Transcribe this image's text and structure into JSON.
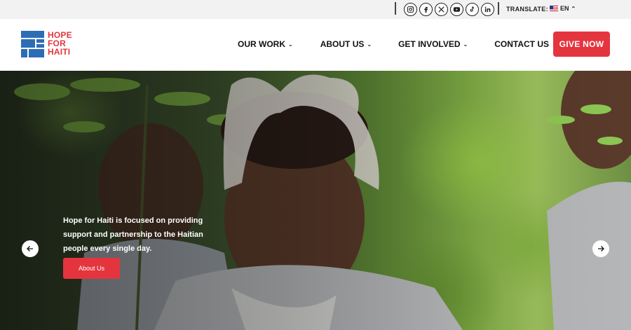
{
  "topbar": {
    "social_icons": [
      "instagram-icon",
      "facebook-icon",
      "x-icon",
      "youtube-icon",
      "tiktok-icon",
      "linkedin-icon"
    ],
    "translate_label": "TRANSLATE:",
    "language": "EN"
  },
  "header": {
    "logo_lines": [
      "HOPE",
      "FOR",
      "HAITI"
    ],
    "nav": [
      {
        "label": "OUR WORK",
        "has_dropdown": true
      },
      {
        "label": "ABOUT US",
        "has_dropdown": true
      },
      {
        "label": "GET INVOLVED",
        "has_dropdown": true
      },
      {
        "label": "CONTACT US",
        "has_dropdown": false
      }
    ],
    "cta_label": "GIVE NOW"
  },
  "hero": {
    "text_lines": [
      "Hope for Haiti is focused on providing",
      "support and partnership to the Haitian",
      "people every single day."
    ],
    "button_label": "About Us"
  },
  "colors": {
    "accent": "#e4353f",
    "brand_blue": "#2d6db5"
  }
}
